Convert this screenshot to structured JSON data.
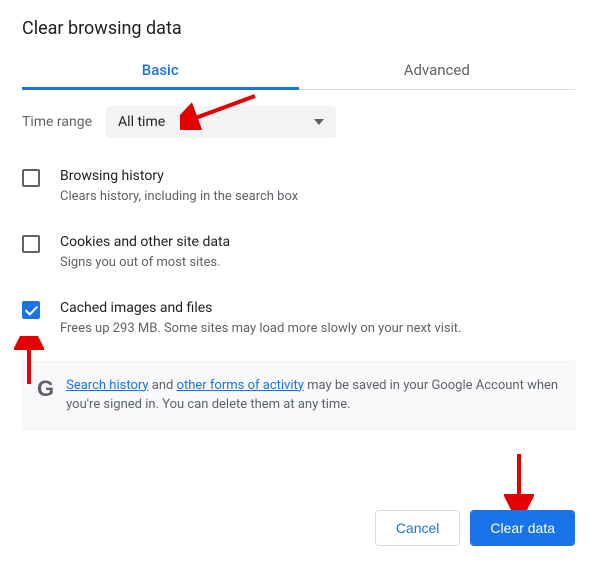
{
  "title": "Clear browsing data",
  "tabs": {
    "basic": "Basic",
    "advanced": "Advanced"
  },
  "time_range": {
    "label": "Time range",
    "value": "All time"
  },
  "options": [
    {
      "title": "Browsing history",
      "desc": "Clears history, including in the search box",
      "checked": false
    },
    {
      "title": "Cookies and other site data",
      "desc": "Signs you out of most sites.",
      "checked": false
    },
    {
      "title": "Cached images and files",
      "desc": "Frees up 293 MB. Some sites may load more slowly on your next visit.",
      "checked": true
    }
  ],
  "info": {
    "link1": "Search history",
    "mid1": " and ",
    "link2": "other forms of activity",
    "rest": " may be saved in your Google Account when you're signed in. You can delete them at any time."
  },
  "buttons": {
    "cancel": "Cancel",
    "clear": "Clear data"
  }
}
